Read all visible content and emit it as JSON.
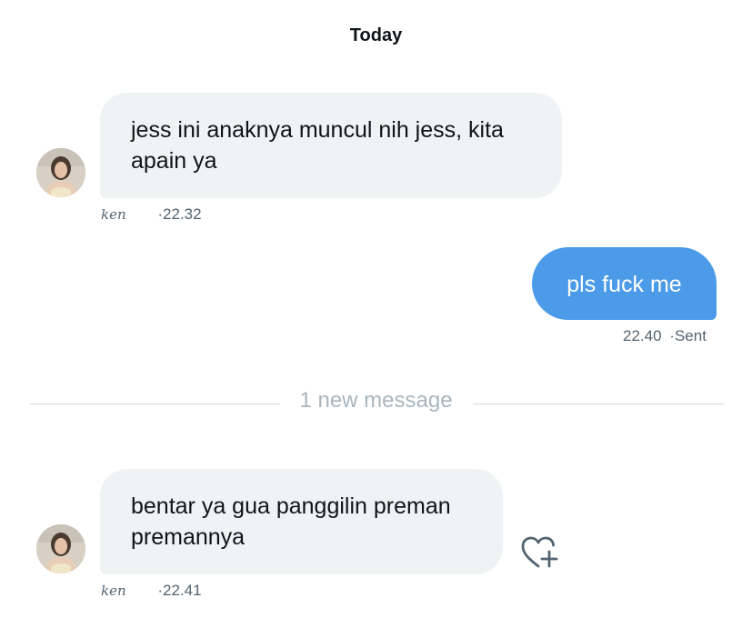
{
  "header": {
    "date_label": "Today"
  },
  "messages": [
    {
      "direction": "incoming",
      "text": "jess ini anaknya muncul nih jess, kita apain ya",
      "sender": "ken",
      "time": "·22.32"
    },
    {
      "direction": "outgoing",
      "text": "pls fuck me",
      "time": "22.40",
      "status": "·Sent"
    },
    {
      "direction": "incoming",
      "text": "bentar ya gua panggilin preman premannya",
      "sender": "ken",
      "time": "·22.41"
    }
  ],
  "divider": {
    "label": "1 new message"
  },
  "icons": {
    "reaction": "heart-plus-icon",
    "avatar": "user-avatar"
  },
  "colors": {
    "incoming_bubble": "#eff3f4",
    "outgoing_bubble": "#4c9be8",
    "meta_text": "#536471",
    "divider_text": "#a9b6bf"
  }
}
